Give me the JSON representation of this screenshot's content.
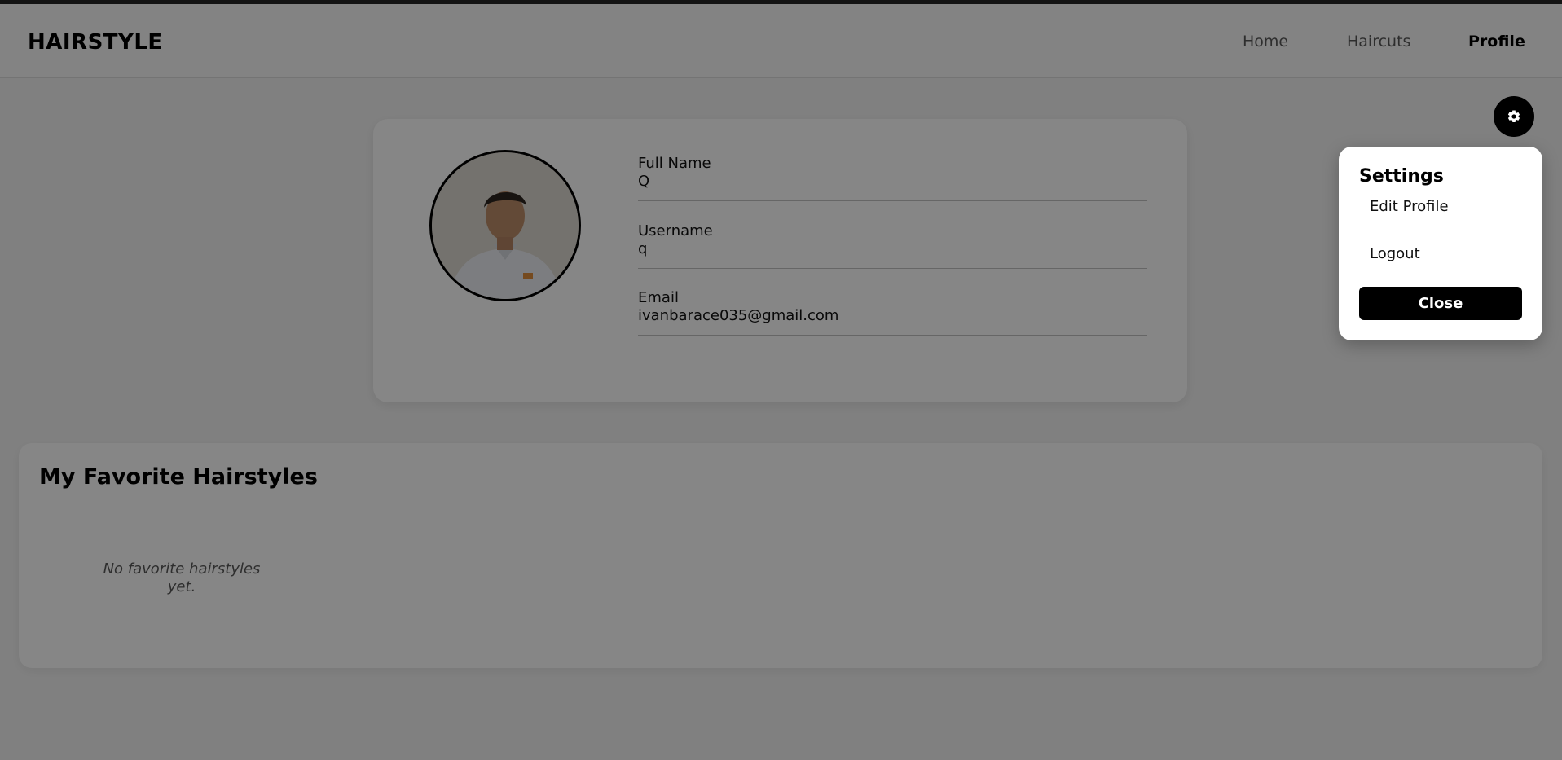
{
  "navbar": {
    "brand": "HAIRSTYLE",
    "links": [
      {
        "label": "Home"
      },
      {
        "label": "Haircuts"
      },
      {
        "label": "Profile"
      }
    ]
  },
  "profile": {
    "fields": [
      {
        "label": "Full Name",
        "value": "Q"
      },
      {
        "label": "Username",
        "value": "q"
      },
      {
        "label": "Email",
        "value": "ivanbarace035@gmail.com"
      }
    ]
  },
  "favorites": {
    "title": "My Favorite Hairstyles",
    "empty_text": "No favorite hairstyles yet."
  },
  "settings": {
    "icon": "gear-icon",
    "title": "Settings",
    "items": [
      {
        "label": "Edit Profile"
      },
      {
        "label": "Logout"
      }
    ],
    "close_label": "Close"
  },
  "colors": {
    "overlay": "#000000",
    "button": "#000000",
    "panel": "#ffffff"
  }
}
